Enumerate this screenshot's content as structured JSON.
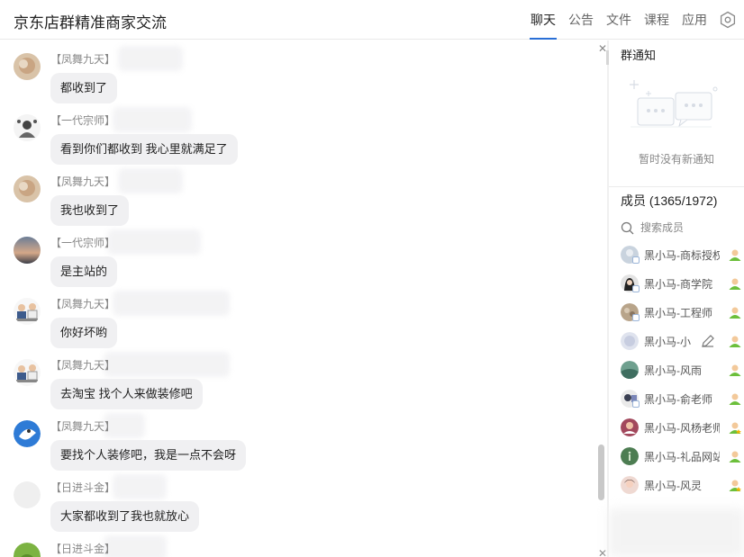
{
  "header": {
    "title": "京东店群精准商家交流",
    "tabs": [
      {
        "label": "聊天",
        "active": true
      },
      {
        "label": "公告",
        "active": false
      },
      {
        "label": "文件",
        "active": false
      },
      {
        "label": "课程",
        "active": false
      },
      {
        "label": "应用",
        "active": false
      }
    ],
    "settings_icon": "hexagon-gear-icon",
    "accent_color": "#2a6fd6"
  },
  "chat": {
    "messages": [
      {
        "name": "【凤舞九天】",
        "text": "都收到了"
      },
      {
        "name": "【一代宗师】",
        "text": "看到你们都收到 我心里就满足了"
      },
      {
        "name": "【凤舞九天】",
        "text": "我也收到了"
      },
      {
        "name": "【一代宗师】",
        "text": "是主站的"
      },
      {
        "name": "【凤舞九天】",
        "text": "你好坏哟"
      },
      {
        "name": "【凤舞九天】",
        "text": "去淘宝 找个人来做装修吧"
      },
      {
        "name": "【凤舞九天】",
        "text": "要找个人装修吧，我是一点不会呀"
      },
      {
        "name": "【日进斗金】",
        "text": "大家都收到了我也就放心"
      },
      {
        "name": "【日进斗金】",
        "text": ""
      }
    ],
    "close_icon": "close-icon"
  },
  "sidebar": {
    "notice_title": "群通知",
    "notice_empty": "暂时没有新通知",
    "members_title": "成员 (1365/1972)",
    "search_placeholder": "搜索成员",
    "members": [
      {
        "name": "黑小马-商标授权",
        "role": "admin"
      },
      {
        "name": "黑小马-商学院",
        "role": "admin"
      },
      {
        "name": "黑小马-工程师",
        "role": "admin"
      },
      {
        "name": "黑小马-小",
        "role": "admin"
      },
      {
        "name": "黑小马-风雨",
        "role": "admin"
      },
      {
        "name": "黑小马-俞老师",
        "role": "admin"
      },
      {
        "name": "黑小马-风杨老师",
        "role": "owner"
      },
      {
        "name": "黑小马-礼品网站",
        "role": "admin"
      },
      {
        "name": "黑小马-风灵",
        "role": "owner"
      }
    ]
  }
}
